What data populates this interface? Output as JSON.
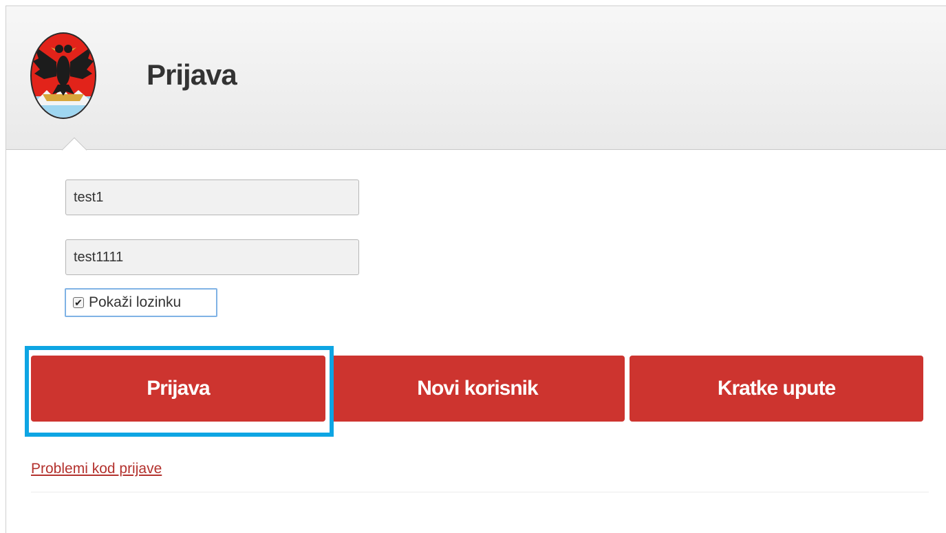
{
  "header": {
    "title": "Prijava",
    "logo_icon": "coat-of-arms-icon"
  },
  "form": {
    "username_value": "test1",
    "password_value": "test1111",
    "show_password_label": "Pokaži lozinku",
    "show_password_checked": true
  },
  "buttons": {
    "login_label": "Prijava",
    "new_user_label": "Novi korisnik",
    "help_label": "Kratke upute"
  },
  "links": {
    "problems_label": "Problemi kod prijave"
  },
  "colors": {
    "button_red": "#cd342f",
    "highlight_blue": "#0ea5e3",
    "link_red": "#b3312d"
  }
}
